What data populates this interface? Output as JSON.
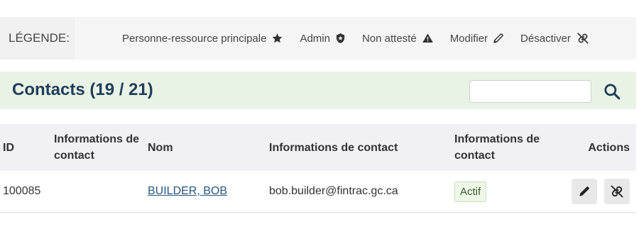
{
  "legend": {
    "label": "LÉGENDE:",
    "items": [
      {
        "label": "Personne-ressource principale",
        "icon": "star-icon"
      },
      {
        "label": "Admin",
        "icon": "shield-icon"
      },
      {
        "label": "Non attesté",
        "icon": "warning-icon"
      },
      {
        "label": "Modifier",
        "icon": "pencil-icon"
      },
      {
        "label": "Désactiver",
        "icon": "unlink-icon"
      }
    ]
  },
  "panel": {
    "title": "Contacts (19 / 21)",
    "search": {
      "value": "",
      "placeholder": "",
      "icon": "search-icon"
    }
  },
  "table": {
    "headers": {
      "id": "ID",
      "contact_info_1": "Informations de contact",
      "name": "Nom",
      "contact_info": "Informations de contact",
      "contact_info_2": "Informations de contact",
      "actions": "Actions"
    },
    "rows": [
      {
        "id": "100085",
        "contact_info_1": "",
        "name": "BUILDER, BOB",
        "email": "bob.builder@fintrac.gc.ca",
        "status": "Actif"
      }
    ]
  },
  "colors": {
    "panel_bg": "#e9f3e5",
    "title": "#1f3d5a",
    "link": "#26577f",
    "badge_bg": "#eef7e8"
  }
}
